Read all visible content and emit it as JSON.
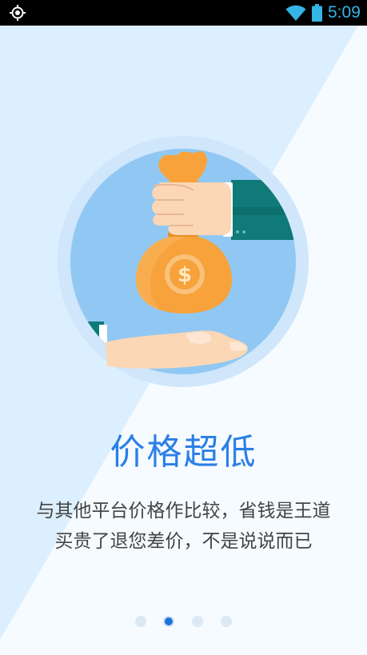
{
  "status_bar": {
    "time": "5:09",
    "left_icon": "gps-icon",
    "right_icons": [
      "wifi-icon",
      "battery-icon"
    ]
  },
  "onboarding": {
    "illustration": "money-bag-handoff",
    "title": "价格超低",
    "description_lines": [
      "与其他平台价格作比较，省钱是王道",
      "买贵了退您差价，不是说说而已"
    ],
    "page_indicator": {
      "total": 4,
      "active_index": 1
    }
  },
  "colors": {
    "accent": "#2b7fe6",
    "background_light": "#f5fbff",
    "background_blue": "#dceffe",
    "status_bar": "#000000",
    "status_icons": "#33b5e5"
  }
}
